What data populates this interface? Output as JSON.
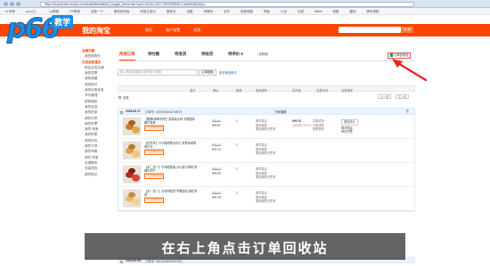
{
  "browser": {
    "url": "https://buyertrade.taobao.com/trade/itemlist/list_bought_items.htm?spm=a21bo.2017.1997525045.2.4afd31d6Q9Qu",
    "bookmarks": [
      "bi 哔哩",
      "ps ps工...",
      "ps教程",
      "PS教程",
      "百度一下",
      "微信网页版",
      "网易云音乐",
      "爱奇艺",
      "优酷",
      "淘宝网",
      "京东",
      "百度地图",
      "网盘",
      "小说",
      "天猫",
      "bilibili",
      "邮箱",
      "翻译",
      "腾讯视频"
    ]
  },
  "logo": {
    "mark": "p66",
    "tag": "教学"
  },
  "header": {
    "brand": "我的淘宝",
    "nav": [
      "首页",
      "账户设置",
      "消息"
    ],
    "search_button": "搜 索"
  },
  "sidebar": {
    "items": [
      {
        "label": "全部功能",
        "kind": "head"
      },
      {
        "label": "我的购物车",
        "kind": "sub"
      },
      {
        "label": "已买到的宝贝",
        "kind": "head"
      },
      {
        "label": "购买过的店铺",
        "kind": "sub"
      },
      {
        "label": "我的发票",
        "kind": "sub"
      },
      {
        "label": "我的收藏",
        "kind": "sub"
      },
      {
        "label": "我的积分",
        "kind": "sub"
      },
      {
        "label": "我的优惠信息",
        "kind": "sub"
      },
      {
        "label": "评价管理",
        "kind": "sub"
      },
      {
        "label": "退款维权",
        "kind": "sub"
      },
      {
        "label": "我的足迹",
        "kind": "sub"
      },
      {
        "label": "我的拍卖",
        "kind": "sub"
      },
      {
        "label": "我的分享",
        "kind": "sub"
      },
      {
        "label": "我的彩票",
        "kind": "sub"
      },
      {
        "label": "我的 淘宝",
        "kind": "sub"
      },
      {
        "label": "我的阿里",
        "kind": "sub"
      },
      {
        "label": "我的红包",
        "kind": "sub"
      },
      {
        "label": "我的卡券",
        "kind": "sub"
      },
      {
        "label": "我的淘客",
        "kind": "sub"
      },
      {
        "label": "我的 淘宝",
        "kind": "sub"
      },
      {
        "label": "店铺服务",
        "kind": "sub"
      },
      {
        "label": "流量钱包",
        "kind": "sub"
      },
      {
        "label": "我的粉丝",
        "kind": "sub"
      }
    ]
  },
  "tabs": [
    {
      "label": "所有订单",
      "active": true
    },
    {
      "label": "待付款"
    },
    {
      "label": "待发货"
    },
    {
      "label": "待收货"
    },
    {
      "label": "待评价 6"
    },
    {
      "label": "分阶段"
    }
  ],
  "recycle_button": "订单回收站",
  "order_search": {
    "placeholder": "输入商品标题或订单号进行搜索",
    "button": "订单搜索",
    "more": "更多筛选条件"
  },
  "columns": [
    "宝贝",
    "单价",
    "数量",
    "商品操作",
    "实付款",
    "交易状态",
    "交易操作"
  ],
  "pager": {
    "select_all": "全选",
    "prev": "上一页",
    "next": "下一页"
  },
  "orders": [
    {
      "date": "2018-06-17",
      "number": "订单号: 163033094874687S",
      "shop": "方家铺铺",
      "items": [
        {
          "name": "【酸辣/烧烤/孜然】猫耳朵大师 手撕猫耳 脆口零食 ...",
          "tag": "7天无理由退货",
          "old_price": "¥39.80",
          "price": "¥16.87",
          "qty": "1",
          "service": [
            "申请售后",
            "投诉卖家",
            "退运保险已失效"
          ],
          "total": [
            "¥49.13",
            "(含运费: ¥5.00)"
          ],
          "status": [
            "交易成功",
            "订单详情",
            "查看物流"
          ],
          "ops": [
            "追加评价",
            "再次购买",
            "申请开票"
          ]
        },
        {
          "name": "【送芥末】卡卡鲜虾酥大虾片 虾条休闲零食小吃 ...",
          "tag": "7天无理由退货",
          "old_price": "¥39.80",
          "price": "¥22.12",
          "qty": "1",
          "service": [
            "申请售后",
            "投诉卖家",
            "退运保险已失效"
          ]
        },
        {
          "name": "【买二送一】牛肉粒散装 办公室小零食 香辣牛肉干 ...",
          "tag": "7天无理由退货",
          "old_price": "¥29.80",
          "price": "¥16.99",
          "qty": "1",
          "service": [
            "申请售后",
            "投诉卖家",
            "退运保险已失效"
          ]
        },
        {
          "name": "【买一送一】大块肉松饼 早餐面包 网红零食 ...",
          "tag": "7天无理由退货",
          "old_price": "¥29.80",
          "price": "¥10.16",
          "qty": "1",
          "service": [
            "申请售后",
            "投诉卖家",
            "退运保险已失效"
          ]
        }
      ]
    },
    {
      "date": "2018-06-08",
      "number": "订单号: 158184080966749S"
    }
  ],
  "subtitle": "在右上角点击订单回收站",
  "colors": {
    "taobao_orange": "#ff4400",
    "arrow_red": "#e8251c",
    "logo_blue": "#1e8de0"
  }
}
